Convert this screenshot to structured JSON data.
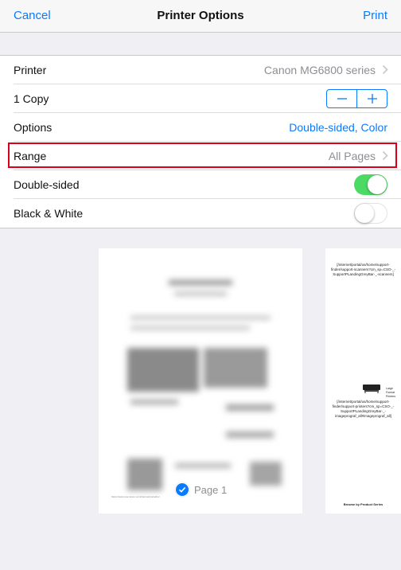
{
  "navbar": {
    "cancel": "Cancel",
    "title": "Printer Options",
    "print": "Print"
  },
  "rows": {
    "printer": {
      "label": "Printer",
      "value": "Canon MG6800 series"
    },
    "copies": {
      "label": "1 Copy"
    },
    "options": {
      "label": "Options",
      "value": "Double-sided, Color"
    },
    "range": {
      "label": "Range",
      "value": "All Pages"
    },
    "double_sided": {
      "label": "Double-sided",
      "on": true
    },
    "black_white": {
      "label": "Black & White",
      "on": false
    }
  },
  "preview": {
    "page1_label": "Page 1",
    "page2": {
      "link1": "[/internet/portal/us/home/support-finder/support-scanners?cm_sp=CSO-_-SupportPLandingGreyBar-_-scanners]",
      "caption": "Large Format Printers",
      "link2": "[/internet/portal/us/home/support-finder/support-printers?cm_sp=CSO-_-SupportPLandingGreyBar-_-imageprograf_all#imageprograf_all]",
      "browse": "Browse by Product Series"
    }
  },
  "colors": {
    "accent": "#0a7aff",
    "toggle_on": "#4cd964",
    "highlight": "#d9001b"
  }
}
